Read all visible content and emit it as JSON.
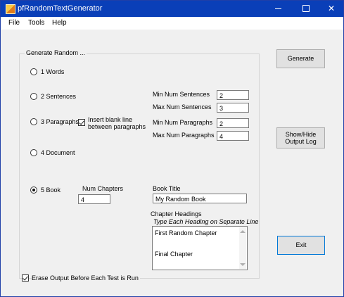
{
  "window": {
    "title": "pfRandomTextGenerator",
    "icon": "app-icon"
  },
  "titlebar_buttons": {
    "minimize": "–",
    "maximize": "☐",
    "close": "✕"
  },
  "menu": {
    "items": [
      "File",
      "Tools",
      "Help"
    ]
  },
  "group": {
    "label": "Generate Random ...",
    "radios": [
      {
        "label": "1 Words",
        "checked": false
      },
      {
        "label": "2 Sentences",
        "checked": false
      },
      {
        "label": "3 Paragraphs",
        "checked": false
      },
      {
        "label": "4 Document",
        "checked": false
      },
      {
        "label": "5 Book",
        "checked": true
      }
    ],
    "insert_blank_line": {
      "label_line1": "Insert blank line",
      "label_line2": "between paragraphs",
      "checked": true
    },
    "sentences": {
      "min_label": "Min Num Sentences",
      "min_value": "2",
      "max_label": "Max Num Sentences",
      "max_value": "3"
    },
    "paragraphs": {
      "min_label": "Min Num Paragraphs",
      "min_value": "2",
      "max_label": "Max Num Paragraphs",
      "max_value": "4"
    },
    "chapters": {
      "label": "Num Chapters",
      "value": "4"
    },
    "book_title": {
      "label": "Book Title",
      "value": "My Random Book"
    },
    "chapter_headings": {
      "label": "Chapter Headings",
      "hint": "Type Each Heading on Separate Line",
      "lines": [
        "First Random Chapter",
        "",
        "Final Chapter"
      ]
    }
  },
  "erase_output": {
    "label": "Erase Output Before Each Test is Run",
    "checked": true
  },
  "buttons": {
    "generate": "Generate",
    "show_hide_line1": "Show/Hide",
    "show_hide_line2": "Output Log",
    "exit": "Exit"
  }
}
